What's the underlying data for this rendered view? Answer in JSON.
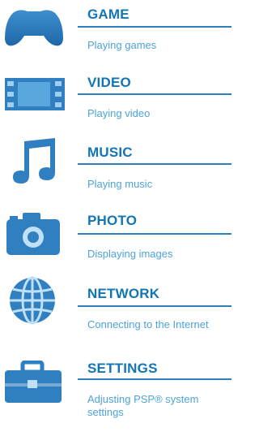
{
  "accent_color": "#2d7fc0",
  "icon_color": "#2f7fc1",
  "items": [
    {
      "icon": "gamepad-icon",
      "title": "GAME",
      "description": "Playing games"
    },
    {
      "icon": "film-strip-icon",
      "title": "VIDEO",
      "description": "Playing video"
    },
    {
      "icon": "music-note-icon",
      "title": "MUSIC",
      "description": "Playing music"
    },
    {
      "icon": "camera-icon",
      "title": "PHOTO",
      "description": "Displaying images"
    },
    {
      "icon": "globe-icon",
      "title": "NETWORK",
      "description": "Connecting to the Internet"
    },
    {
      "icon": "toolbox-icon",
      "title": "SETTINGS",
      "description": "Adjusting PSP® system settings"
    }
  ]
}
